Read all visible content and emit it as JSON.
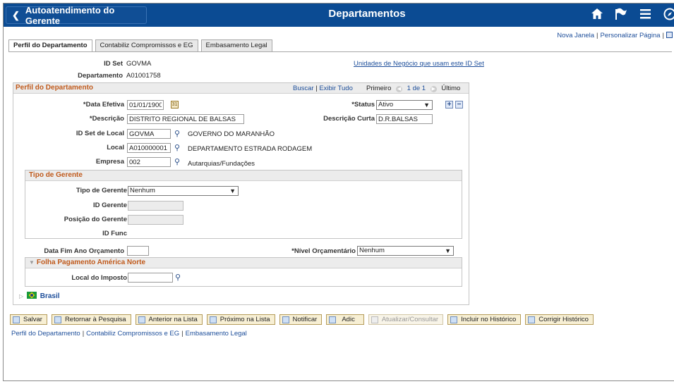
{
  "banner": {
    "back_label": "Autoatendimento do Gerente",
    "title": "Departamentos",
    "bg_color": "#0b4b93"
  },
  "top_links": {
    "new_window": "Nova Janela",
    "personalize": "Personalizar Página"
  },
  "tabs": [
    {
      "label": "Perfil do Departamento",
      "active": true
    },
    {
      "label": "Contabiliz Compromissos e EG",
      "active": false
    },
    {
      "label": "Embasamento Legal",
      "active": false
    }
  ],
  "header": {
    "setid_label": "ID Set",
    "setid_value": "GOVMA",
    "dept_label": "Departamento",
    "dept_value": "A01001758",
    "bu_link": "Unidades de Negócio que usam este ID Set"
  },
  "profile": {
    "title": "Perfil do Departamento",
    "find": "Buscar",
    "view_all": "Exibir Tudo",
    "first": "Primeiro",
    "counter": "1 de 1",
    "last": "Último",
    "eff_date_label": "*Data Efetiva",
    "eff_date_value": "01/01/1900",
    "status_label": "*Status",
    "status_value": "Ativo",
    "descr_label": "*Descrição",
    "descr_value": "DISTRITO REGIONAL DE BALSAS",
    "short_descr_label": "Descrição Curta",
    "short_descr_value": "D.R.BALSAS",
    "loc_setid_label": "ID Set de Local",
    "loc_setid_value": "GOVMA",
    "loc_setid_desc": "GOVERNO DO MARANHÃO",
    "location_label": "Local",
    "location_value": "A010000001",
    "location_desc": "DEPARTAMENTO ESTRADA RODAGEM",
    "company_label": "Empresa",
    "company_value": "002",
    "company_desc": "Autarquias/Fundações"
  },
  "manager": {
    "title": "Tipo de Gerente",
    "type_label": "Tipo de Gerente",
    "type_value": "Nenhum",
    "id_label": "ID Gerente",
    "id_value": "",
    "position_label": "Posição do Gerente",
    "position_value": "",
    "func_label": "ID Func"
  },
  "budget": {
    "year_end_label": "Data Fim Ano Orçamento",
    "year_end_value": "",
    "level_label": "*Nível Orçamentário",
    "level_value": "Nenhum"
  },
  "payroll": {
    "title": "Folha Pagamento América Norte",
    "tax_label": "Local do Imposto",
    "tax_value": ""
  },
  "brasil": {
    "label": "Brasil"
  },
  "toolbar": {
    "save": "Salvar",
    "return": "Retornar à Pesquisa",
    "prev": "Anterior na Lista",
    "next": "Próximo na Lista",
    "notify": "Notificar",
    "add": "Adic",
    "update": "Atualizar/Consultar",
    "include_history": "Incluir no Histórico",
    "correct_history": "Corrigir Histórico"
  },
  "bottom_links": [
    "Perfil do Departamento",
    "Contabiliz Compromissos e EG",
    "Embasamento Legal"
  ]
}
